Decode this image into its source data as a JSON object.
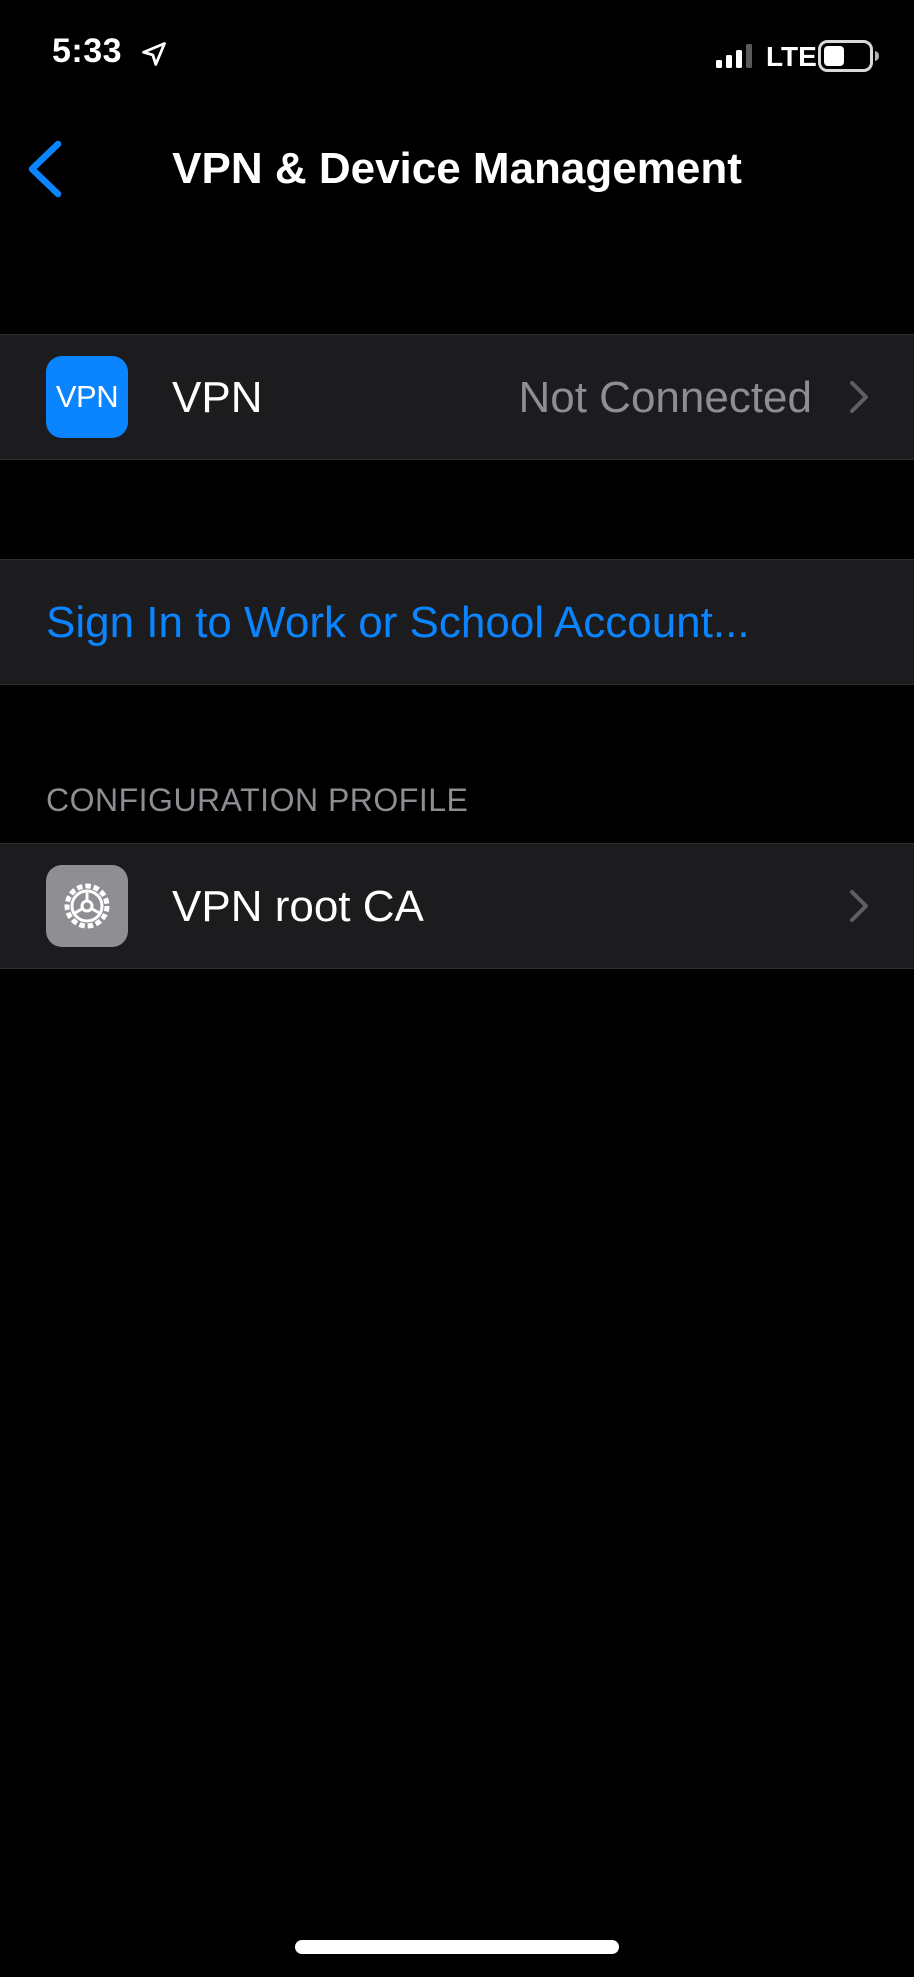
{
  "status_bar": {
    "time": "5:33",
    "network": "LTE",
    "icons": [
      "location-arrow-icon",
      "signal-bars-icon",
      "battery-icon"
    ]
  },
  "nav": {
    "title": "VPN & Device Management",
    "back_icon": "chevron-left-icon"
  },
  "vpn_row": {
    "icon_text": "VPN",
    "label": "VPN",
    "value": "Not Connected"
  },
  "account_row": {
    "label": "Sign In to Work or School Account..."
  },
  "configuration_profile": {
    "header": "CONFIGURATION PROFILE",
    "items": [
      {
        "label": "VPN root CA",
        "icon": "settings-gear-icon"
      }
    ]
  },
  "colors": {
    "background": "#000000",
    "row_background": "#1c1c1e",
    "accent": "#0a84ff",
    "secondary_text": "#8d8d93"
  }
}
